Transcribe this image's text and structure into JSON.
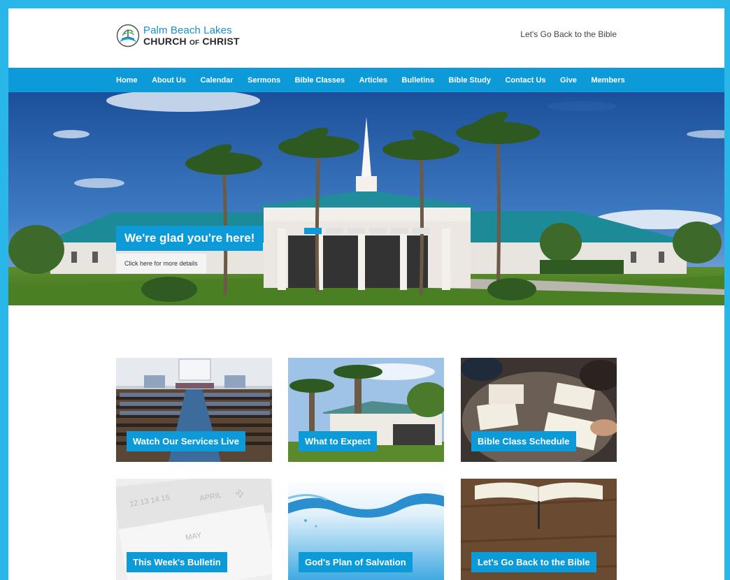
{
  "header": {
    "logo_line1": "Palm Beach Lakes",
    "logo_line2_a": "CHURCH",
    "logo_line2_b": "OF",
    "logo_line2_c": "CHRIST",
    "tagline": "Let's Go Back to the Bible"
  },
  "nav": {
    "items": [
      "Home",
      "About Us",
      "Calendar",
      "Sermons",
      "Bible Classes",
      "Articles",
      "Bulletins",
      "Bible Study",
      "Contact Us",
      "Give",
      "Members"
    ]
  },
  "hero": {
    "title": "We're glad you're here!",
    "button": "Click here for more details",
    "slides_total": 6,
    "active_slide": 1
  },
  "tiles": [
    {
      "label": "Watch Our Services Live"
    },
    {
      "label": "What to Expect"
    },
    {
      "label": "Bible Class Schedule"
    },
    {
      "label": "This Week's Bulletin"
    },
    {
      "label": "God's Plan of Salvation"
    },
    {
      "label": "Let's Go Back to the Bible"
    }
  ],
  "colors": {
    "accent": "#0d9ad9",
    "frame": "#29b6e8"
  }
}
